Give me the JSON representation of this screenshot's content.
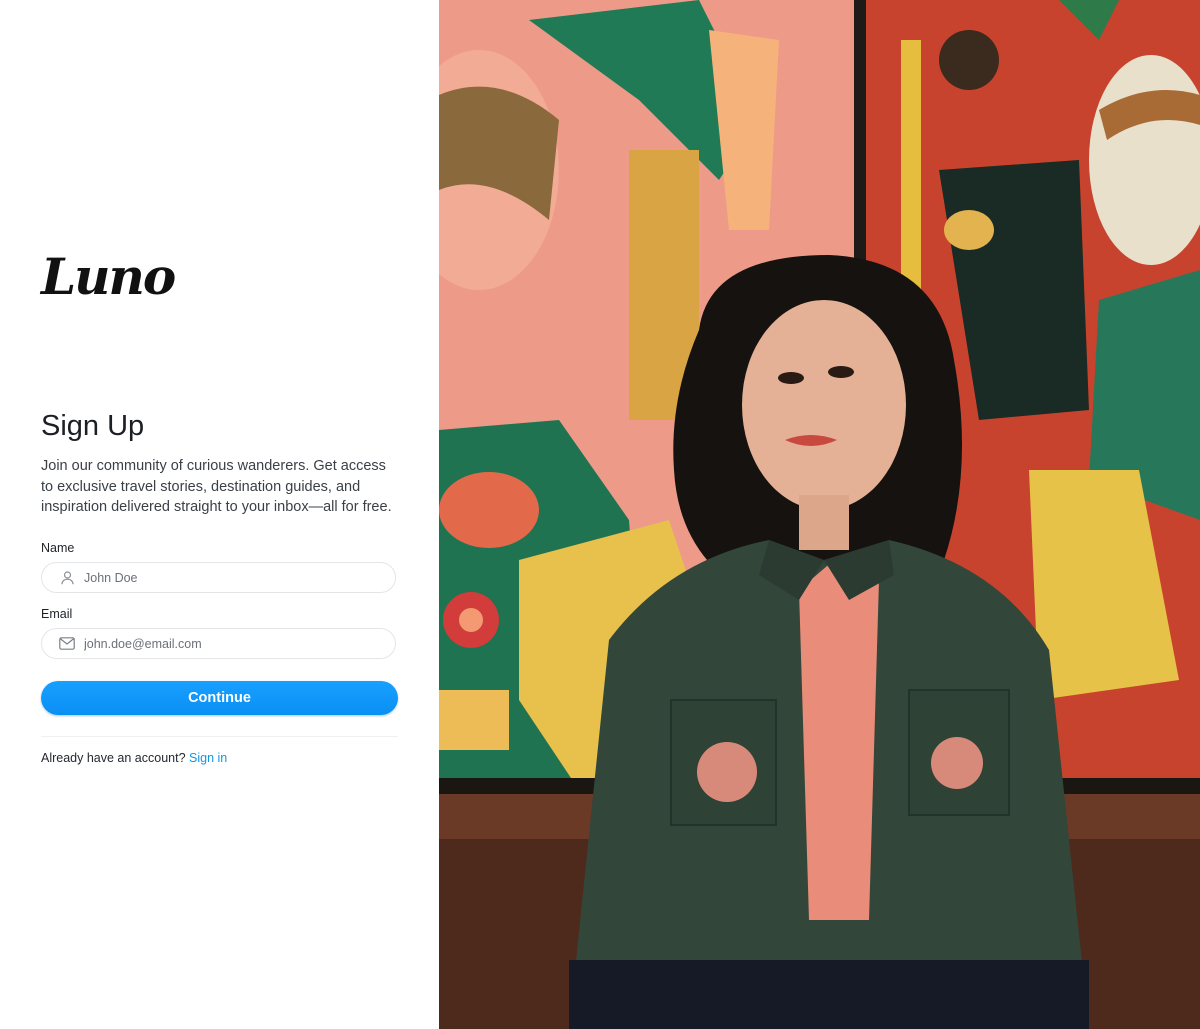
{
  "brand": {
    "logo_text": "Luno"
  },
  "form": {
    "title": "Sign Up",
    "description": "Join our community of curious wanderers. Get access to exclusive travel stories, destination guides, and inspiration delivered straight to your inbox—all for free.",
    "name": {
      "label": "Name",
      "placeholder": "John Doe",
      "icon": "user-icon"
    },
    "email": {
      "label": "Email",
      "placeholder": "john.doe@email.com",
      "icon": "mail-icon"
    },
    "submit_label": "Continue",
    "signin_prompt": "Already have an account?",
    "signin_link": "Sign in"
  },
  "colors": {
    "accent": "#0a94f8",
    "link": "#1396e6"
  }
}
